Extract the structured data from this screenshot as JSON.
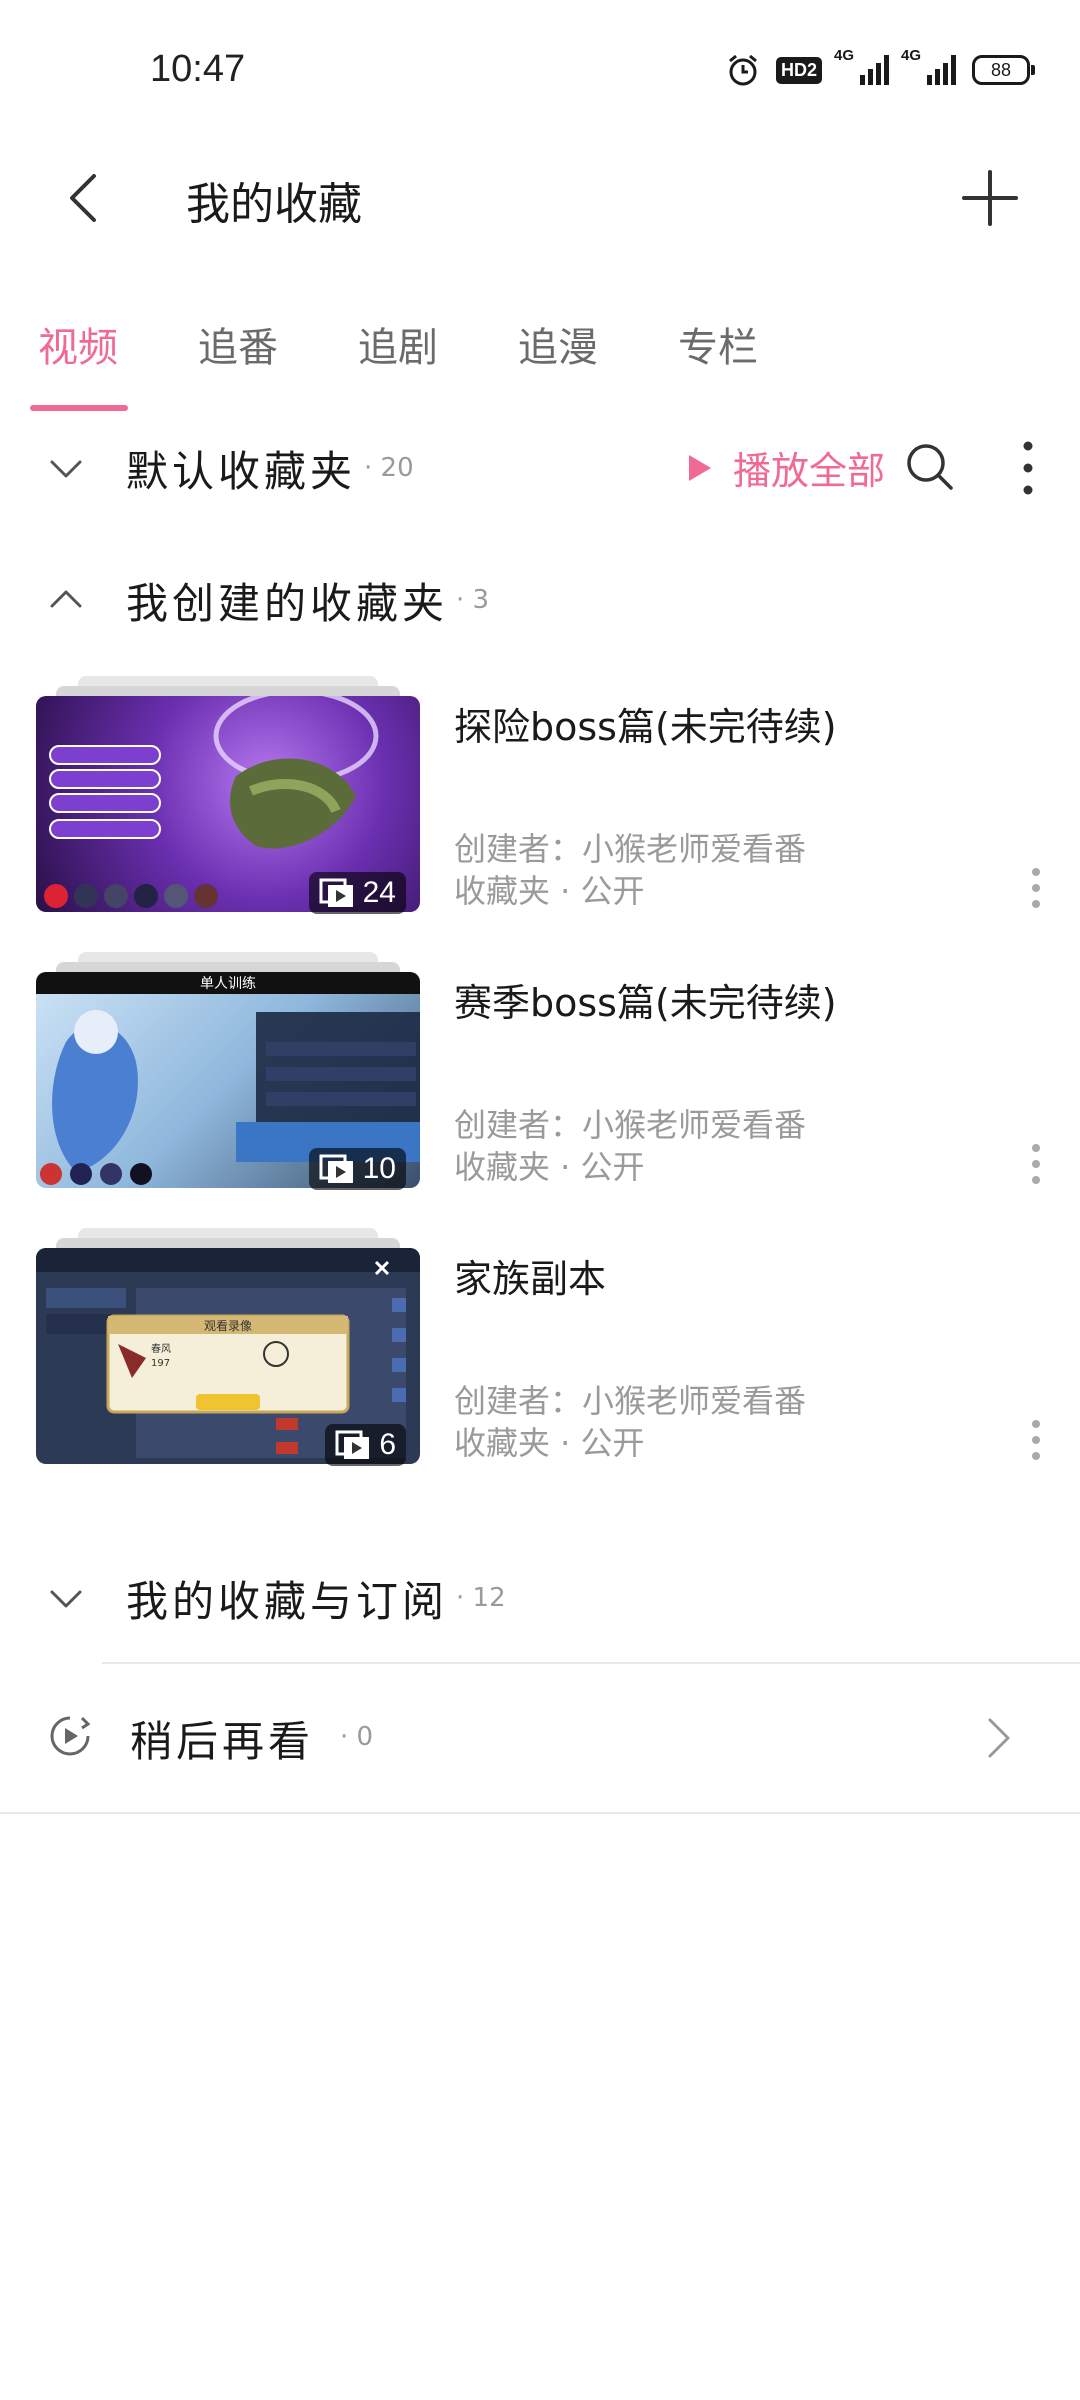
{
  "status_bar": {
    "time": "10:47",
    "hd_badge": "HD2",
    "signal_1": "4G",
    "signal_2": "4G",
    "battery": "88"
  },
  "header": {
    "title": "我的收藏"
  },
  "tabs": [
    {
      "label": "视频",
      "active": true
    },
    {
      "label": "追番",
      "active": false
    },
    {
      "label": "追剧",
      "active": false
    },
    {
      "label": "追漫",
      "active": false
    },
    {
      "label": "专栏",
      "active": false
    }
  ],
  "default_folder": {
    "title": "默认收藏夹",
    "count": "· 20",
    "play_all": "播放全部"
  },
  "created_group": {
    "title": "我创建的收藏夹",
    "count": "· 3"
  },
  "folders": [
    {
      "title": "探险boss篇(未完待续)",
      "count": "24",
      "creator": "创建者：小猴老师爱看番",
      "meta": "收藏夹 · 公开"
    },
    {
      "title": "赛季boss篇(未完待续)",
      "count": "10",
      "creator": "创建者：小猴老师爱看番",
      "meta": "收藏夹 · 公开"
    },
    {
      "title": "家族副本",
      "count": "6",
      "creator": "创建者：小猴老师爱看番",
      "meta": "收藏夹 · 公开"
    }
  ],
  "thumb_text": {
    "t2_header": "单人训练",
    "t3_header": "观看录像",
    "t3_name": "春风",
    "t3_num": "197"
  },
  "subscriptions": {
    "title": "我的收藏与订阅",
    "count": "· 12"
  },
  "watch_later": {
    "title": "稍后再看",
    "count": "· 0"
  },
  "colors": {
    "accent": "#f06b94",
    "text": "#1a1a1a",
    "muted": "#9a9a9a"
  }
}
